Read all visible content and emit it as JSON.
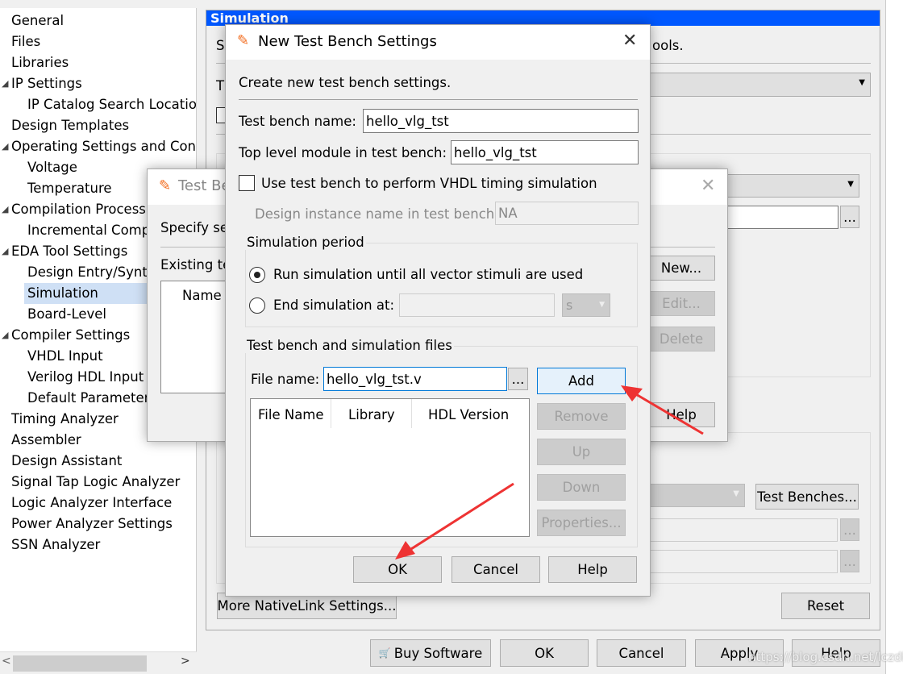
{
  "tree": {
    "items": [
      {
        "label": "General",
        "level": 0
      },
      {
        "label": "Files",
        "level": 0
      },
      {
        "label": "Libraries",
        "level": 0
      },
      {
        "label": "IP Settings",
        "level": 0,
        "expanded": true
      },
      {
        "label": "IP Catalog Search Location",
        "level": 1
      },
      {
        "label": "Design Templates",
        "level": 0
      },
      {
        "label": "Operating Settings and Conditions",
        "level": 0,
        "expanded": true
      },
      {
        "label": "Voltage",
        "level": 1
      },
      {
        "label": "Temperature",
        "level": 1
      },
      {
        "label": "Compilation Process Settings",
        "level": 0,
        "expanded": true
      },
      {
        "label": "Incremental Compilation",
        "level": 1
      },
      {
        "label": "EDA Tool Settings",
        "level": 0,
        "expanded": true
      },
      {
        "label": "Design Entry/Synthesis",
        "level": 1
      },
      {
        "label": "Simulation",
        "level": 1,
        "selected": true
      },
      {
        "label": "Board-Level",
        "level": 1
      },
      {
        "label": "Compiler Settings",
        "level": 0,
        "expanded": true
      },
      {
        "label": "VHDL Input",
        "level": 1
      },
      {
        "label": "Verilog HDL Input",
        "level": 1
      },
      {
        "label": "Default Parameters",
        "level": 1
      },
      {
        "label": "Timing Analyzer",
        "level": 0
      },
      {
        "label": "Assembler",
        "level": 0
      },
      {
        "label": "Design Assistant",
        "level": 0
      },
      {
        "label": "Signal Tap Logic Analyzer",
        "level": 0
      },
      {
        "label": "Logic Analyzer Interface",
        "level": 0
      },
      {
        "label": "Power Analyzer Settings",
        "level": 0
      },
      {
        "label": "SSN Analyzer",
        "level": 0
      }
    ]
  },
  "main": {
    "title": "Simulation",
    "desc_start": "S",
    "desc_end": "ools.",
    "tool_label_start": "T",
    "more_nativelink": "More NativeLink Settings...",
    "test_benches": "Test Benches...",
    "reset": "Reset",
    "browse": "..."
  },
  "footer": {
    "buy": "Buy Software",
    "ok": "OK",
    "cancel": "Cancel",
    "apply": "Apply",
    "help": "Help",
    "watermark": "https://blog.csdn.net/lczdk"
  },
  "tbs_dialog": {
    "title": "Test Bench Settings",
    "specify": "Specify settings for each test bench.",
    "existing": "Existing test bench settings:",
    "col_name": "Name",
    "new": "New...",
    "edit": "Edit...",
    "delete": "Delete",
    "help": "Help"
  },
  "new_dialog": {
    "title": "New Test Bench Settings",
    "intro": "Create new test bench settings.",
    "tb_name_label": "Test bench name:",
    "tb_name": "hello_vlg_tst",
    "top_label": "Top level module in test bench:",
    "top": "hello_vlg_tst",
    "vhdl_check": "Use test bench to perform VHDL timing simulation",
    "vhdl_checked": false,
    "instance_label": "Design instance name in test bench:",
    "instance": "NA",
    "period_group": "Simulation period",
    "run_all": "Run simulation until all vector stimuli are used",
    "run_all_selected": true,
    "end_at": "End simulation at:",
    "end_value": "",
    "end_unit": "s",
    "files_group": "Test bench and simulation files",
    "file_label": "File name:",
    "file_value": "hello_vlg_tst.v",
    "browse": "...",
    "add": "Add",
    "remove": "Remove",
    "up": "Up",
    "down": "Down",
    "properties": "Properties...",
    "columns": [
      "File Name",
      "Library",
      "HDL Version"
    ],
    "ok": "OK",
    "cancel": "Cancel",
    "help": "Help"
  },
  "colors": {
    "title_blue": "#0058ff",
    "annotation_arrow": "#ee3333"
  }
}
